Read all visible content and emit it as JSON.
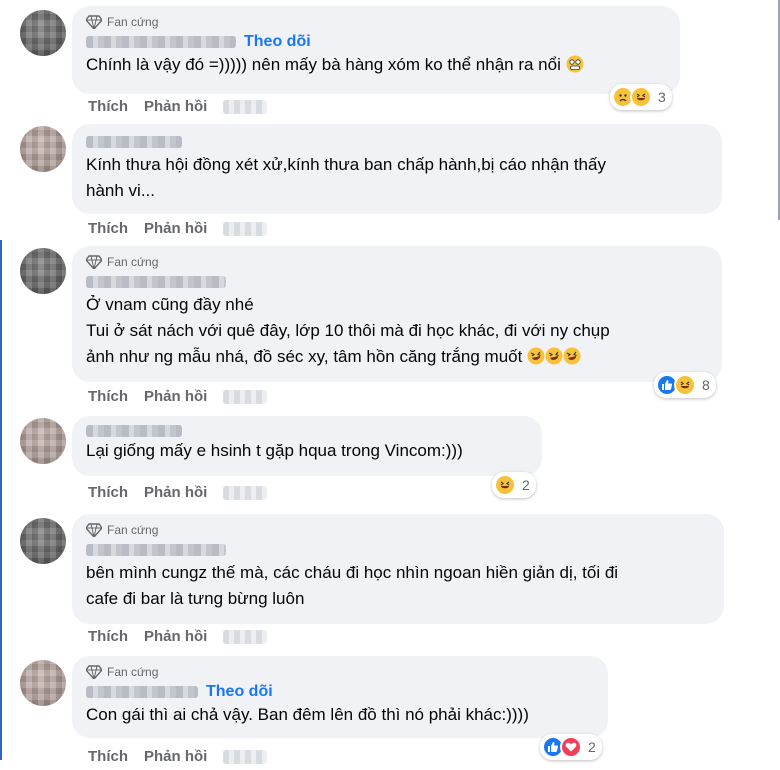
{
  "labels": {
    "like": "Thích",
    "reply": "Phản hồi",
    "fan_badge": "Fan cứng",
    "follow": "Theo dõi"
  },
  "colors": {
    "bubble_bg": "#f0f2f5",
    "action_text": "#65676b",
    "link_blue": "#1877f2"
  },
  "comments": [
    {
      "badge": "Fan cứng",
      "follow": "Theo dõi",
      "lines": [
        "Chính là vậy đó =))))) nên mấy bà hàng xóm ko thể nhận ra nổi"
      ],
      "inline_emoji": "grimacing-face-icon",
      "reactions": [
        "sad",
        "haha"
      ],
      "reaction_count": "3"
    },
    {
      "lines": [
        "Kính thưa hội đồng xét xử,kính thưa ban chấp hành,bị cáo nhận thấy",
        "hành vi..."
      ]
    },
    {
      "badge": "Fan cứng",
      "lines": [
        "Ở vnam cũng đầy nhé",
        "Tui ở sát nách với quê đây, lớp 10 thôi mà đi học khác, đi với ny chụp",
        "ảnh như ng mẫu nhá, đồ séc xy, tâm hồn căng trắng muốt"
      ],
      "inline_emoji": "rolling-laughing-icon",
      "reactions": [
        "like",
        "haha"
      ],
      "reaction_count": "8"
    },
    {
      "lines": [
        "Lại giống mấy e hsinh t gặp hqua trong Vincom:)))"
      ],
      "reactions": [
        "haha"
      ],
      "reaction_count": "2"
    },
    {
      "badge": "Fan cứng",
      "lines": [
        "bên mình cungz thế mà, các cháu đi học nhìn ngoan hiền giản dị, tối đi",
        "cafe đi bar là tưng bừng luôn"
      ]
    },
    {
      "badge": "Fan cứng",
      "follow": "Theo dõi",
      "lines": [
        "Con gái thì ai chả vậy. Ban đêm lên đồ thì nó phải khác:))))"
      ],
      "reactions": [
        "like",
        "love"
      ],
      "reaction_count": "2"
    }
  ]
}
